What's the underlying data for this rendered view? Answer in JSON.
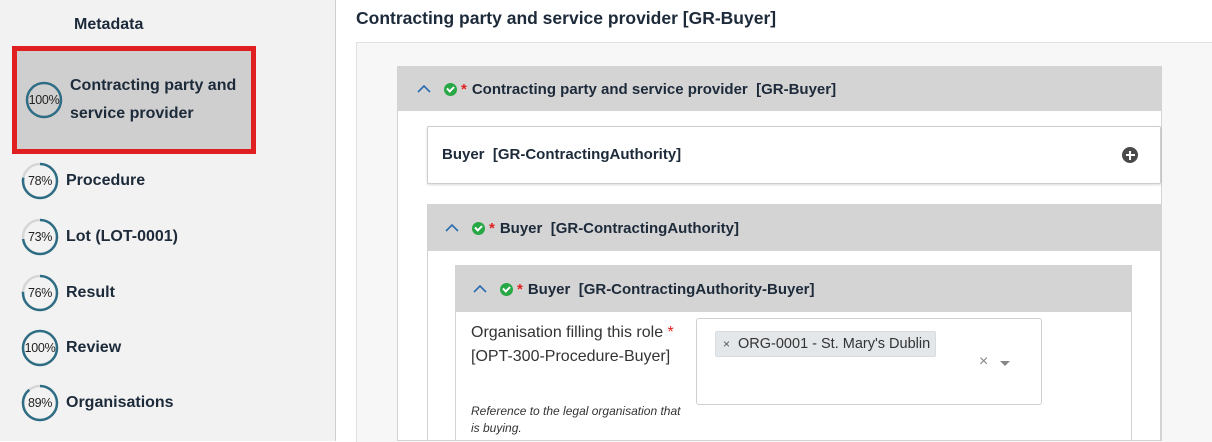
{
  "sidebar": {
    "title": "Metadata",
    "items": [
      {
        "label": "Contracting party and service provider",
        "percent": "100%",
        "progress": 1.0
      },
      {
        "label": "Procedure",
        "percent": "78%",
        "progress": 0.78
      },
      {
        "label": "Lot (LOT-0001)",
        "percent": "73%",
        "progress": 0.73
      },
      {
        "label": "Result",
        "percent": "76%",
        "progress": 0.76
      },
      {
        "label": "Review",
        "percent": "100%",
        "progress": 1.0
      },
      {
        "label": "Organisations",
        "percent": "89%",
        "progress": 0.89
      }
    ],
    "selected_index": 0
  },
  "main": {
    "title": "Contracting party and service provider [GR-Buyer]",
    "section": {
      "required_mark": "*",
      "title": "Contracting party and service provider  [GR-Buyer]"
    },
    "buyer_group": {
      "title": "Buyer  [GR-ContractingAuthority]"
    },
    "buyer_section": {
      "required_mark": "*",
      "title": "Buyer  [GR-ContractingAuthority]"
    },
    "buyer_sub": {
      "required_mark": "*",
      "title": "Buyer  [GR-ContractingAuthority-Buyer]"
    },
    "field": {
      "label_before": "Organisation filling this role ",
      "required_mark": "*",
      "label_after": " [OPT-300-Procedure-Buyer]",
      "help": "Reference to the legal organisation that is buying.",
      "selected_value": "ORG-0001 - St. Mary's Dublin",
      "remove_glyph": "×",
      "clear_glyph": "×"
    }
  },
  "colors": {
    "accent": "#2f6d85",
    "selected_border": "#e02020",
    "check": "#28a745",
    "required": "#e02020",
    "chevron": "#2b6cb0"
  }
}
